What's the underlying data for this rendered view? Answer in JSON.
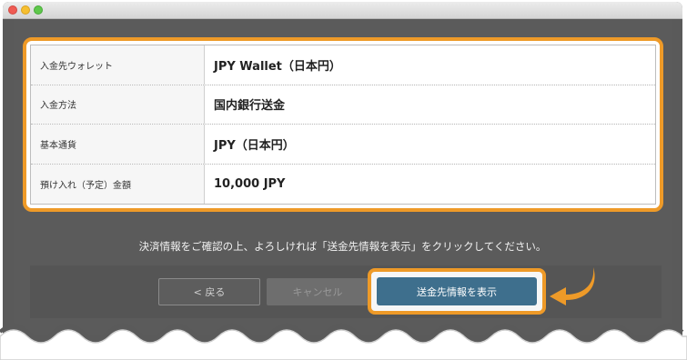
{
  "window": {
    "controls": [
      "close",
      "minimize",
      "zoom"
    ]
  },
  "details": {
    "rows": [
      {
        "label": "入金先ウォレット",
        "value": "JPY Wallet（日本円）"
      },
      {
        "label": "入金方法",
        "value": "国内銀行送金"
      },
      {
        "label": "基本通貨",
        "value": "JPY（日本円）"
      },
      {
        "label": "預け入れ（予定）金額",
        "value": "10,000 JPY"
      }
    ]
  },
  "note": "決済情報をご確認の上、よろしければ「送金先情報を表示」をクリックしてください。",
  "buttons": {
    "back": "< 戻る",
    "cancel": "キャンセル",
    "show_info": "送金先情報を表示"
  },
  "colors": {
    "highlight": "#ee9a28",
    "primary": "#3e6f8d"
  }
}
